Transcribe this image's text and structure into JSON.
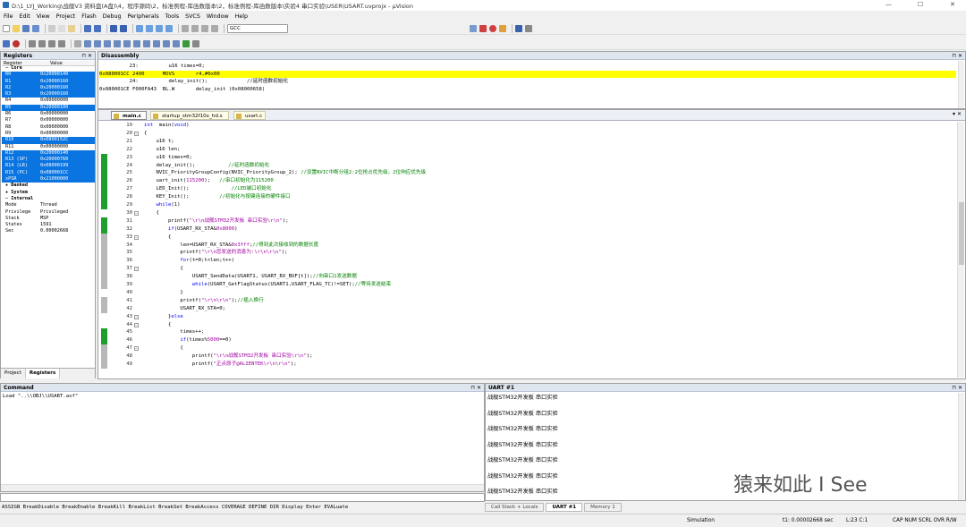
{
  "window": {
    "title": "D:\\1_LYJ_Working\\战舰V3 资料盘(A盘)\\4，程序源码\\2，标准例程-库函数版本\\2，标准例程-库函数版本\\实验4 串口实验\\USER\\USART.uvprojx - µVision",
    "minimize": "—",
    "maximize": "☐",
    "close": "✕"
  },
  "menu": [
    "File",
    "Edit",
    "View",
    "Project",
    "Flash",
    "Debug",
    "Peripherals",
    "Tools",
    "SVCS",
    "Window",
    "Help"
  ],
  "toolbar": {
    "target_combo": "GCC"
  },
  "registers": {
    "panel_title": "Registers",
    "col_register": "Register",
    "col_value": "Value",
    "rows": [
      {
        "name": "─ Core",
        "value": "",
        "sel": false,
        "bold": true
      },
      {
        "name": "R0",
        "value": "0x20000140",
        "sel": true
      },
      {
        "name": "R1",
        "value": "0x20000160",
        "sel": true
      },
      {
        "name": "R2",
        "value": "0x20000160",
        "sel": true
      },
      {
        "name": "R3",
        "value": "0x20000160",
        "sel": true
      },
      {
        "name": "R4",
        "value": "0x00000000",
        "sel": false
      },
      {
        "name": "R5",
        "value": "0x20000100",
        "sel": true
      },
      {
        "name": "R6",
        "value": "0x00000000",
        "sel": false
      },
      {
        "name": "R7",
        "value": "0x00000000",
        "sel": false
      },
      {
        "name": "R8",
        "value": "0x00000000",
        "sel": false
      },
      {
        "name": "R9",
        "value": "0x00000000",
        "sel": false
      },
      {
        "name": "R10",
        "value": "0x0800152C",
        "sel": true
      },
      {
        "name": "R11",
        "value": "0x00000000",
        "sel": false
      },
      {
        "name": "R12",
        "value": "0x20000140",
        "sel": true
      },
      {
        "name": "R13 (SP)",
        "value": "0x20000760",
        "sel": true
      },
      {
        "name": "R14 (LR)",
        "value": "0x08000199",
        "sel": true
      },
      {
        "name": "R15 (PC)",
        "value": "0x080001CC",
        "sel": true
      },
      {
        "name": "xPSR",
        "value": "0x21000000",
        "sel": true
      },
      {
        "name": "+ Banked",
        "value": "",
        "sel": false,
        "bold": true
      },
      {
        "name": "+ System",
        "value": "",
        "sel": false,
        "bold": true
      },
      {
        "name": "─ Internal",
        "value": "",
        "sel": false,
        "bold": true
      },
      {
        "name": "   Mode",
        "value": "Thread",
        "sel": false
      },
      {
        "name": "   Privilege",
        "value": "Privileged",
        "sel": false
      },
      {
        "name": "   Stack",
        "value": "MSP",
        "sel": false
      },
      {
        "name": "   States",
        "value": "1591",
        "sel": false
      },
      {
        "name": "   Sec",
        "value": "0.00002668",
        "sel": false
      }
    ],
    "tab_project": "Project",
    "tab_registers": "Registers"
  },
  "disassembly": {
    "panel_title": "Disassembly",
    "lines": [
      {
        "text": "          23:          u16 times=0;",
        "hl": false
      },
      {
        "text": "0x080001CC 2400      MOVS       r4,#0x00",
        "hl": true
      },
      {
        "text": "          24:          delay_init();             //延时函数初始化",
        "hl": false
      },
      {
        "text": "0x080001CE F000FA43  BL.W       delay_init (0x08000658)",
        "hl": false
      }
    ]
  },
  "editor": {
    "tabs": [
      "main.c",
      "startup_stm32f10x_hd.s",
      "usart.c"
    ],
    "active_tab": 0,
    "lines": [
      {
        "n": "19",
        "fold": "",
        "mk": "",
        "h": [
          [
            "kw",
            "int"
          ],
          [
            "",
            "  main("
          ],
          [
            "kw",
            "void"
          ],
          [
            "",
            ")"
          ]
        ]
      },
      {
        "n": "20",
        "fold": "−",
        "mk": "",
        "h": [
          [
            "",
            "{"
          ]
        ]
      },
      {
        "n": "21",
        "fold": "",
        "mk": "",
        "h": [
          [
            "",
            "    u16 t;"
          ]
        ]
      },
      {
        "n": "22",
        "fold": "",
        "mk": "",
        "h": [
          [
            "",
            "    u16 len;"
          ]
        ]
      },
      {
        "n": "23",
        "fold": "",
        "mk": "g",
        "h": [
          [
            "",
            "    u16 times=0;"
          ]
        ]
      },
      {
        "n": "24",
        "fold": "",
        "mk": "g",
        "h": [
          [
            "",
            "    delay_init();           "
          ],
          [
            "cm",
            "//延时函数初始化"
          ]
        ]
      },
      {
        "n": "25",
        "fold": "",
        "mk": "g",
        "h": [
          [
            "",
            "    NVIC_PriorityGroupConfig(NVIC_PriorityGroup_2); "
          ],
          [
            "cm",
            "//设置NVIC中断分组2:2位抢占优先级，2位响应优先级"
          ]
        ]
      },
      {
        "n": "26",
        "fold": "",
        "mk": "g",
        "h": [
          [
            "",
            "    uart_init("
          ],
          [
            "st",
            "115200"
          ],
          [
            "",
            ");   "
          ],
          [
            "cm",
            "//串口初始化为115200"
          ]
        ]
      },
      {
        "n": "27",
        "fold": "",
        "mk": "g",
        "h": [
          [
            "",
            "    LED_Init();              "
          ],
          [
            "cm",
            "//LED端口初始化"
          ]
        ]
      },
      {
        "n": "28",
        "fold": "",
        "mk": "g",
        "h": [
          [
            "",
            "    KEY_Init();          "
          ],
          [
            "cm",
            "//初始化与按键连接的硬件接口"
          ]
        ]
      },
      {
        "n": "29",
        "fold": "",
        "mk": "g",
        "h": [
          [
            "",
            "    "
          ],
          [
            "kw",
            "while"
          ],
          [
            "",
            "(1)"
          ]
        ]
      },
      {
        "n": "30",
        "fold": "−",
        "mk": "",
        "h": [
          [
            "",
            "    {"
          ]
        ]
      },
      {
        "n": "31",
        "fold": "",
        "mk": "g",
        "h": [
          [
            "",
            "        printf("
          ],
          [
            "st",
            "\"\\r\\n战舰STM32开发板 串口实验\\r\\n\""
          ],
          [
            "",
            ");"
          ]
        ]
      },
      {
        "n": "32",
        "fold": "",
        "mk": "g",
        "h": [
          [
            "",
            "        "
          ],
          [
            "kw",
            "if"
          ],
          [
            "",
            "(USART_RX_STA&"
          ],
          [
            "st",
            "0x8000"
          ],
          [
            "",
            ")"
          ]
        ]
      },
      {
        "n": "33",
        "fold": "−",
        "mk": "s",
        "h": [
          [
            "",
            "        {"
          ]
        ]
      },
      {
        "n": "34",
        "fold": "",
        "mk": "s",
        "h": [
          [
            "",
            "            len=USART_RX_STA&"
          ],
          [
            "st",
            "0x3fff"
          ],
          [
            "",
            ";"
          ],
          [
            "cm",
            "//得到此次接收到的数据长度"
          ]
        ]
      },
      {
        "n": "35",
        "fold": "",
        "mk": "s",
        "h": [
          [
            "",
            "            printf("
          ],
          [
            "st",
            "\"\\r\\n您发送的消息为:\\r\\n\\r\\n\""
          ],
          [
            "",
            ");"
          ]
        ]
      },
      {
        "n": "36",
        "fold": "",
        "mk": "s",
        "h": [
          [
            "",
            "            "
          ],
          [
            "kw",
            "for"
          ],
          [
            "",
            "(t=0;t<len;t++)"
          ]
        ]
      },
      {
        "n": "37",
        "fold": "−",
        "mk": "s",
        "h": [
          [
            "",
            "            {"
          ]
        ]
      },
      {
        "n": "38",
        "fold": "",
        "mk": "s",
        "h": [
          [
            "",
            "                USART_SendData(USART1, USART_RX_BUF[t]);"
          ],
          [
            "cm",
            "//向串口1发送数据"
          ]
        ]
      },
      {
        "n": "39",
        "fold": "",
        "mk": "s",
        "h": [
          [
            "",
            "                "
          ],
          [
            "kw",
            "while"
          ],
          [
            "",
            "(USART_GetFlagStatus(USART1,USART_FLAG_TC)!=SET);"
          ],
          [
            "cm",
            "//等待发送结束"
          ]
        ]
      },
      {
        "n": "40",
        "fold": "",
        "mk": "",
        "h": [
          [
            "",
            "            }"
          ]
        ]
      },
      {
        "n": "41",
        "fold": "",
        "mk": "s",
        "h": [
          [
            "",
            "            printf("
          ],
          [
            "st",
            "\"\\r\\n\\r\\n\""
          ],
          [
            "",
            ");"
          ],
          [
            "cm",
            "//插入换行"
          ]
        ]
      },
      {
        "n": "42",
        "fold": "",
        "mk": "s",
        "h": [
          [
            "",
            "            USART_RX_STA=0;"
          ]
        ]
      },
      {
        "n": "43",
        "fold": "−",
        "mk": "",
        "h": [
          [
            "",
            "        }"
          ],
          [
            "kw",
            "else"
          ]
        ]
      },
      {
        "n": "44",
        "fold": "−",
        "mk": "",
        "h": [
          [
            "",
            "        {"
          ]
        ]
      },
      {
        "n": "45",
        "fold": "",
        "mk": "g",
        "h": [
          [
            "",
            "            times++;"
          ]
        ]
      },
      {
        "n": "46",
        "fold": "",
        "mk": "g",
        "h": [
          [
            "",
            "            "
          ],
          [
            "kw",
            "if"
          ],
          [
            "",
            "(times%"
          ],
          [
            "st",
            "5000"
          ],
          [
            "",
            "==0)"
          ]
        ]
      },
      {
        "n": "47",
        "fold": "−",
        "mk": "s",
        "h": [
          [
            "",
            "            {"
          ]
        ]
      },
      {
        "n": "48",
        "fold": "",
        "mk": "s",
        "h": [
          [
            "",
            "                printf("
          ],
          [
            "st",
            "\"\\r\\n战舰STM32开发板 串口实验\\r\\n\""
          ],
          [
            "",
            ");"
          ]
        ]
      },
      {
        "n": "49",
        "fold": "",
        "mk": "s",
        "h": [
          [
            "",
            "                printf("
          ],
          [
            "st",
            "\"正点原子@ALIENTEK\\r\\n\\r\\n\""
          ],
          [
            "",
            ");"
          ]
        ]
      }
    ]
  },
  "command": {
    "panel_title": "Command",
    "output": "Load \"..\\\\OBJ\\\\USART.axf\"",
    "hint": "ASSIGN BreakDisable BreakEnable BreakKill BreakList BreakSet BreakAccess COVERAGE DEFINE DIR Display Enter EVALuate"
  },
  "uart": {
    "panel_title": "UART #1",
    "lines": [
      "战舰STM32开发板 串口实验",
      "战舰STM32开发板 串口实验",
      "战舰STM32开发板 串口实验",
      "战舰STM32开发板 串口实验",
      "战舰STM32开发板 串口实验",
      "战舰STM32开发板 串口实验",
      "战舰STM32开发板 串口实验"
    ],
    "tabs": [
      "Call Stack + Locals",
      "UART #1",
      "Memory 1"
    ],
    "active_tab": 1
  },
  "status": {
    "mode": "Simulation",
    "time": "t1: 0.00002668 sec",
    "cursor": "L:23 C:1",
    "caps": "CAP  NUM  SCRL  OVR  R/W"
  },
  "watermark": "猿来如此 I See",
  "colors": {
    "selection": "#0a74e0",
    "highlight": "#ffff00",
    "keyword": "#0000ff",
    "comment": "#008000",
    "string": "#a000a0",
    "marker_green": "#1e9e2e",
    "marker_gray": "#b8b8b8"
  }
}
